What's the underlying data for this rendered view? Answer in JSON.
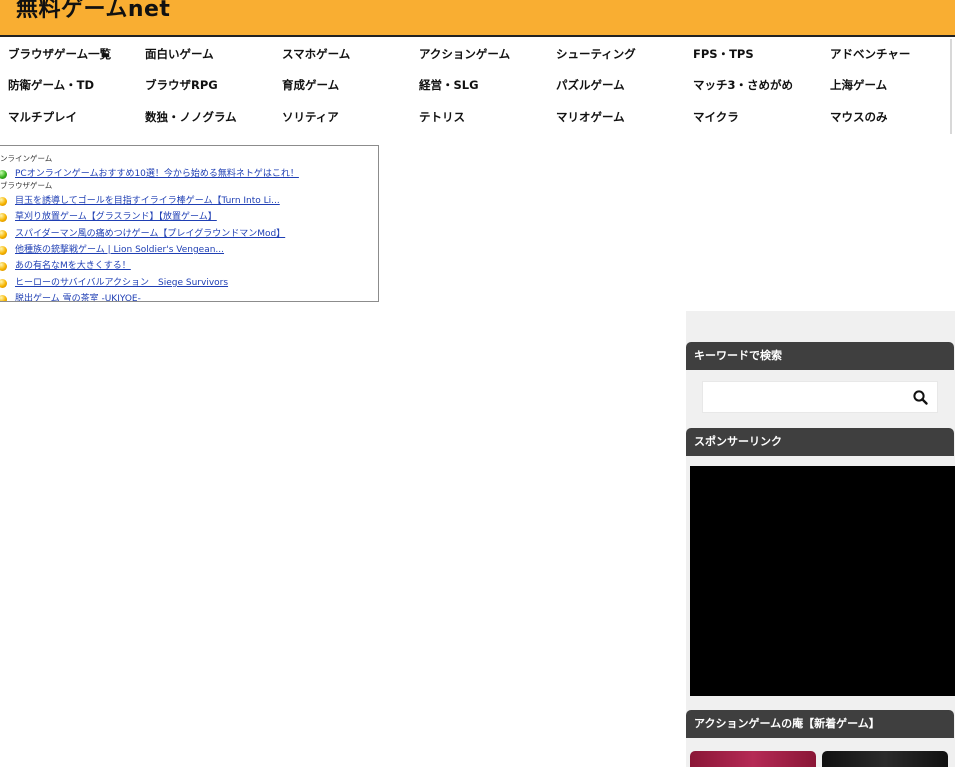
{
  "site": {
    "title": "無料ゲームnet"
  },
  "nav": {
    "categories": [
      "ブラウザゲーム一覧",
      "面白いゲーム",
      "スマホゲーム",
      "アクションゲーム",
      "シューティング",
      "FPS・TPS",
      "アドベンチャー",
      "防衛ゲーム・TD",
      "ブラウザRPG",
      "育成ゲーム",
      "経営・SLG",
      "パズルゲーム",
      "マッチ3・さめがめ",
      "上海ゲーム",
      "マルチプレイ",
      "数独・ノノグラム",
      "ソリティア",
      "テトリス",
      "マリオゲーム",
      "マイクラ",
      "マウスのみ"
    ]
  },
  "game_list": {
    "label_online": "ンラインゲーム",
    "label_browser": "ブラウザゲーム",
    "online_items": [
      "PCオンラインゲームおすすめ10選！今から始める無料ネトゲはこれ！"
    ],
    "browser_items": [
      "目玉を誘導してゴールを目指すイライラ棒ゲーム【Turn Into Li...",
      "草刈り放置ゲーム【グラスランド】【放置ゲーム】",
      "スパイダーマン風の痛めつけゲーム【プレイグラウンドマンMod】",
      "他種族の銃撃戦ゲーム | Lion Soldier's Vengean...",
      "あの有名なMを大きくする！",
      "ヒーローのサバイバルアクション　Siege Survivors",
      "脱出ゲーム 雪の茶室 -UKIYOE-"
    ]
  },
  "sidebar": {
    "search_heading": "キーワードで検索",
    "search_placeholder": "",
    "sponsor_heading": "スポンサーリンク",
    "new_games_heading": "アクションゲームの庵【新着ゲーム】"
  },
  "colors": {
    "header_bg": "#f9ae32",
    "sidebar_heading_bg": "#3f3f3f",
    "link": "#1f3fb4"
  },
  "icons": {
    "search": "magnifier-icon",
    "bullet_online": "green-ball-icon",
    "bullet_browser": "orange-ball-icon"
  }
}
